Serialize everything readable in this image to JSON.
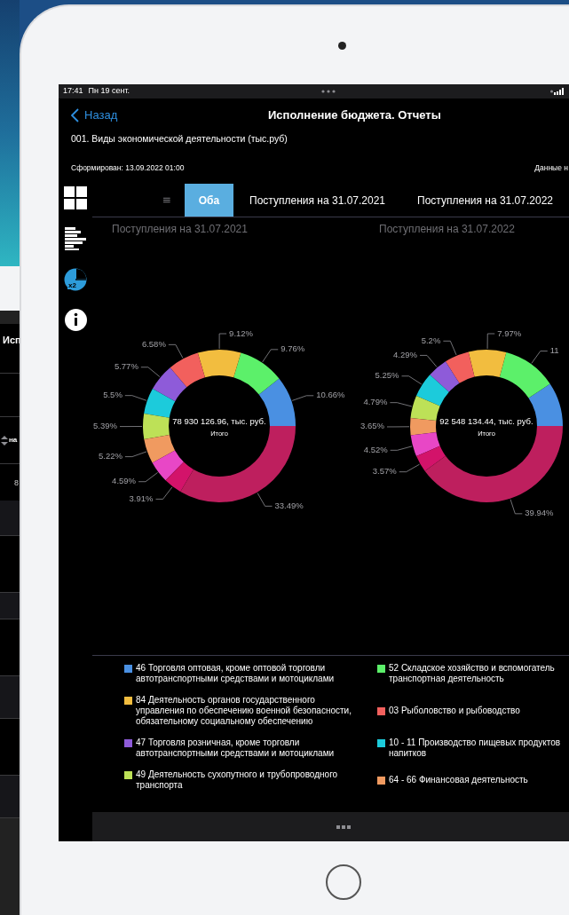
{
  "background_device": {
    "title": "Исп",
    "column_header": "на",
    "cell": "8"
  },
  "status_bar": {
    "time": "17:41",
    "date": "Пн 19 сент."
  },
  "nav": {
    "back": "Назад",
    "title": "Исполнение бюджета. Отчеты"
  },
  "report": {
    "name": "001. Виды экономической деятельности (тыс.руб)",
    "formed": "Сформирован: 13.09.2022 01:00",
    "data_note": "Данные н"
  },
  "sidebar": {
    "items": [
      {
        "kind": "grid",
        "selected": false
      },
      {
        "kind": "bars",
        "selected": false
      },
      {
        "kind": "pie",
        "selected": true,
        "badge": "x2"
      },
      {
        "kind": "info",
        "selected": false
      }
    ]
  },
  "tabs": [
    {
      "label": "Оба",
      "selected": true
    },
    {
      "label": "Поступления на 31.07.2021",
      "selected": false
    },
    {
      "label": "Поступления на 31.07.2022",
      "selected": false
    }
  ],
  "charts": [
    {
      "center_value": "78 930 126.96, тыс. руб.",
      "center_label": "Итого",
      "chart_data": {
        "type": "donut",
        "title": "Поступления на 31.07.2021",
        "colors": [
          "#4a90e2",
          "#5cf06a",
          "#f2bd3f",
          "#f2605d",
          "#8e5bd9",
          "#1ccbdb",
          "#bde157",
          "#f09a60",
          "#e847c6",
          "#d3136a",
          "#be1f5e"
        ],
        "series": [
          {
            "values": [
              10.66,
              9.76,
              9.12,
              6.58,
              5.77,
              5.5,
              5.39,
              5.22,
              4.59,
              3.91,
              33.49
            ]
          }
        ],
        "value_labels": [
          "10.66%",
          "9.76%",
          "9.12%",
          "6.58%",
          "5.77%",
          "5.5%",
          "5.39%",
          "5.22%",
          "4.59%",
          "3.91%",
          "33.49%"
        ]
      }
    },
    {
      "center_value": "92 548 134.44, тыс. руб.",
      "center_label": "Итого",
      "chart_data": {
        "type": "donut",
        "title": "Поступления на 31.07.2022",
        "colors": [
          "#4a90e2",
          "#5cf06a",
          "#f2bd3f",
          "#f2605d",
          "#8e5bd9",
          "#1ccbdb",
          "#bde157",
          "#f09a60",
          "#e847c6",
          "#d3136a",
          "#be1f5e"
        ],
        "series": [
          {
            "values": [
              9.32,
              11.5,
              7.97,
              5.2,
              4.29,
              5.25,
              4.79,
              3.65,
              4.52,
              3.57,
              39.94
            ]
          }
        ],
        "value_labels": [
          null,
          "11",
          "7.97%",
          "5.2%",
          "4.29%",
          "5.25%",
          "4.79%",
          "3.65%",
          "4.52%",
          "3.57%",
          "39.94%"
        ]
      }
    }
  ],
  "legend": {
    "items": [
      {
        "label": "46 Торговля оптовая, кроме оптовой торговли автотранспортными средствами и мотоциклами",
        "color": "#4a90e2"
      },
      {
        "label": "52 Складское хозяйство и вспомогатель транспортная деятельность",
        "color": "#5cf06a"
      },
      {
        "label": "84 Деятельность органов государственного управления по обеспечению военной безопасности, обязательному социальному обеспечению",
        "color": "#f2bd3f"
      },
      {
        "label": "03 Рыболовство и рыбоводство",
        "color": "#f2605d"
      },
      {
        "label": "47 Торговля розничная, кроме торговли автотранспортными средствами и мотоциклами",
        "color": "#8e5bd9"
      },
      {
        "label": "10 - 11 Производство пищевых продуктов напитков",
        "color": "#1ccbdb"
      },
      {
        "label": "49 Деятельность сухопутного и трубопроводного транспорта",
        "color": "#bde157"
      },
      {
        "label": "64 - 66 Финансовая деятельность",
        "color": "#f09a60"
      }
    ]
  }
}
